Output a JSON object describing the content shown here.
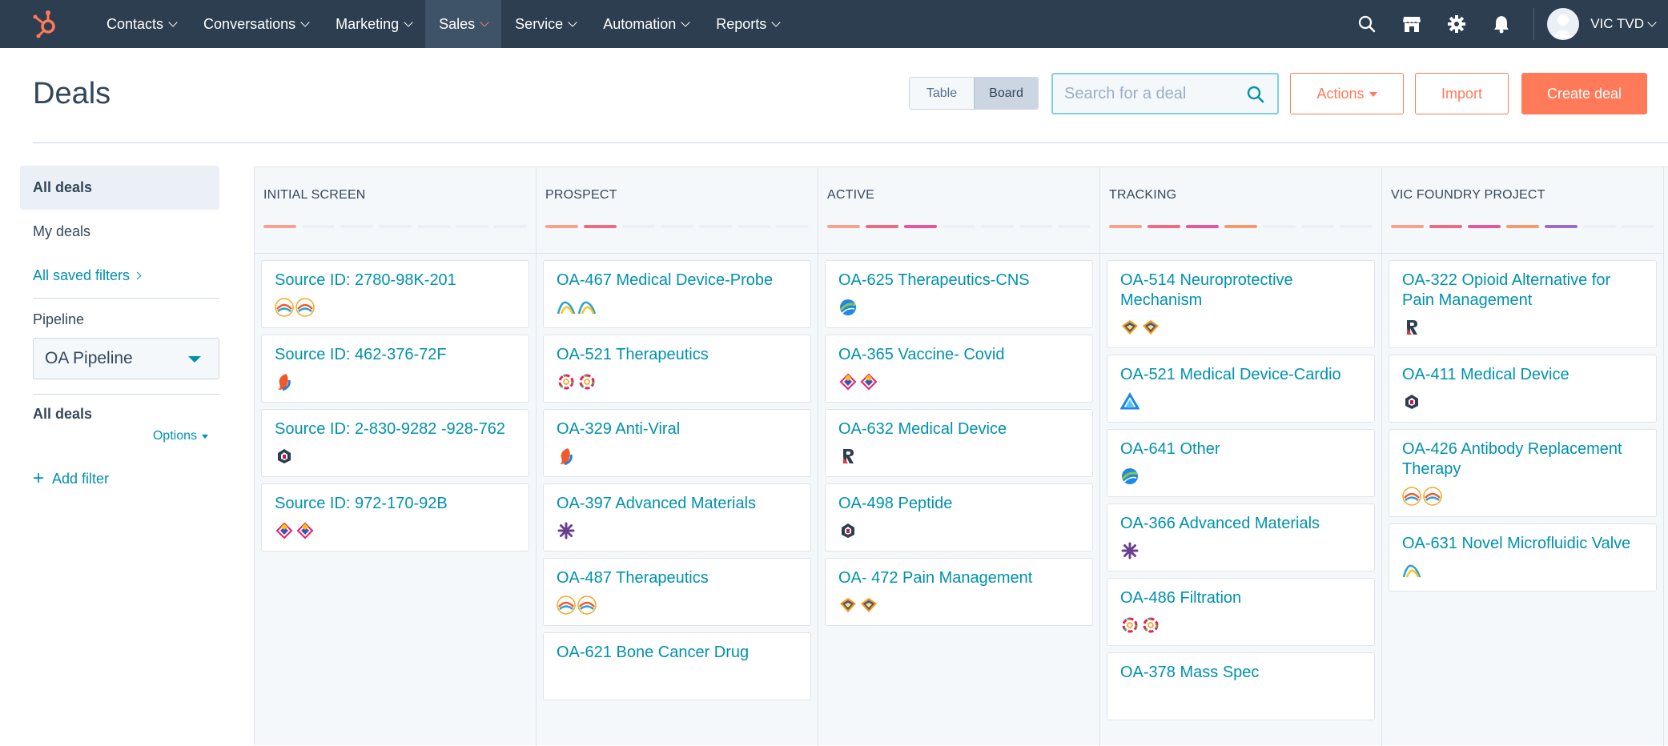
{
  "nav": {
    "items": [
      {
        "label": "Contacts",
        "active": false
      },
      {
        "label": "Conversations",
        "active": false
      },
      {
        "label": "Marketing",
        "active": false
      },
      {
        "label": "Sales",
        "active": true
      },
      {
        "label": "Service",
        "active": false
      },
      {
        "label": "Automation",
        "active": false
      },
      {
        "label": "Reports",
        "active": false
      }
    ],
    "user_name": "VIC TVD"
  },
  "header": {
    "title": "Deals",
    "view_table": "Table",
    "view_board": "Board",
    "search_placeholder": "Search for a deal",
    "actions_label": "Actions",
    "import_label": "Import",
    "create_label": "Create deal"
  },
  "sidebar": {
    "all_deals": "All deals",
    "my_deals": "My deals",
    "saved_filters": "All saved filters",
    "pipeline_label": "Pipeline",
    "pipeline_value": "OA Pipeline",
    "all_deals_2": "All deals",
    "options": "Options",
    "add_filter": "Add filter"
  },
  "colors": {
    "nav_bg": "#2d3e50",
    "accent": "#ff7a59",
    "link": "#0091ae"
  },
  "columns": [
    {
      "title": "INITIAL SCREEN",
      "progress": [
        "#f8a08a"
      ],
      "cards": [
        {
          "title": "Source ID: 2780-98K-201",
          "logos": [
            "sun",
            "sun"
          ]
        },
        {
          "title": "Source ID: 462-376-72F",
          "logos": [
            "swirl"
          ]
        },
        {
          "title": "Source ID: 2-830-9282 -928-762",
          "logos": [
            "hex"
          ]
        },
        {
          "title": "Source ID: 972-170-92B",
          "logos": [
            "diamond",
            "diamond"
          ]
        }
      ]
    },
    {
      "title": "PROSPECT",
      "progress": [
        "#f8a08a",
        "#f2687c"
      ],
      "cards": [
        {
          "title": "OA-467 Medical Device-Probe",
          "logos": [
            "wave",
            "wave"
          ]
        },
        {
          "title": "OA-521 Therapeutics",
          "logos": [
            "ring",
            "ring"
          ]
        },
        {
          "title": "OA-329 Anti-Viral",
          "logos": [
            "swirl"
          ]
        },
        {
          "title": "OA-397 Advanced Materials",
          "logos": [
            "star"
          ]
        },
        {
          "title": "OA-487 Therapeutics",
          "logos": [
            "sun",
            "sun"
          ]
        },
        {
          "title": "OA-621 Bone Cancer Drug",
          "logos": []
        }
      ]
    },
    {
      "title": "ACTIVE",
      "progress": [
        "#f8a08a",
        "#f2687c",
        "#e8559a"
      ],
      "cards": [
        {
          "title": "OA-625 Therapeutics-CNS",
          "logos": [
            "globe"
          ]
        },
        {
          "title": "OA-365 Vaccine- Covid",
          "logos": [
            "diamond",
            "diamond"
          ]
        },
        {
          "title": "OA-632 Medical Device",
          "logos": [
            "rlogo"
          ]
        },
        {
          "title": "OA-498 Peptide",
          "logos": [
            "hex"
          ]
        },
        {
          "title": "OA- 472 Pain Management",
          "logos": [
            "lotus",
            "lotus"
          ]
        }
      ]
    },
    {
      "title": "TRACKING",
      "progress": [
        "#f8a08a",
        "#f2687c",
        "#e8559a",
        "#f59a6c"
      ],
      "cards": [
        {
          "title": "OA-514 Neuroprotective Mechanism",
          "logos": [
            "lotus",
            "lotus"
          ]
        },
        {
          "title": "OA-521 Medical Device-Cardio",
          "logos": [
            "tri"
          ]
        },
        {
          "title": "OA-641 Other",
          "logos": [
            "globe"
          ]
        },
        {
          "title": "OA-366 Advanced Materials",
          "logos": [
            "star"
          ]
        },
        {
          "title": "OA-486 Filtration",
          "logos": [
            "ring",
            "ring"
          ]
        },
        {
          "title": "OA-378 Mass Spec",
          "logos": []
        }
      ]
    },
    {
      "title": "VIC FOUNDRY PROJECT",
      "progress": [
        "#f8a08a",
        "#f2687c",
        "#e8559a",
        "#f59a6c",
        "#9b6cc9"
      ],
      "cards": [
        {
          "title": "OA-322 Opioid Alternative for Pain Management",
          "logos": [
            "rlogo"
          ]
        },
        {
          "title": "OA-411 Medical Device",
          "logos": [
            "hex"
          ]
        },
        {
          "title": "OA-426 Antibody Replacement Therapy",
          "logos": [
            "sun",
            "sun"
          ]
        },
        {
          "title": "OA-631 Novel Microfluidic Valve",
          "logos": [
            "wave"
          ]
        }
      ]
    }
  ]
}
